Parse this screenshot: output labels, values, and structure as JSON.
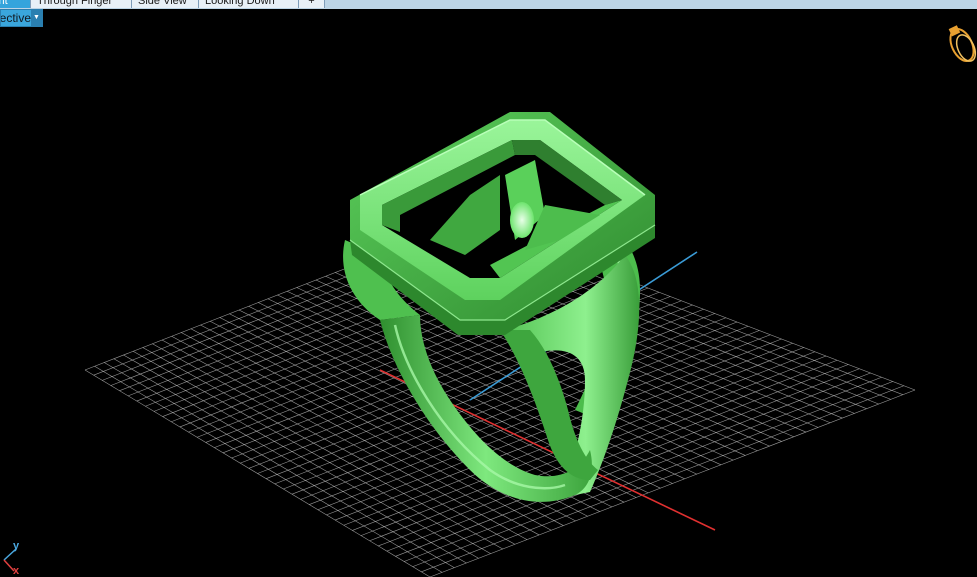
{
  "tabs": [
    {
      "label": "Front"
    },
    {
      "label": "Through Finger"
    },
    {
      "label": "Side View"
    },
    {
      "label": "Looking Down"
    },
    {
      "label": "+"
    }
  ],
  "view_mode": {
    "selected": "Perspective"
  },
  "axes": {
    "y_label": "y",
    "x_label": "x"
  },
  "colors": {
    "background": "#000000",
    "model": "#6ee46e",
    "grid": "#c8c8c8",
    "axis_x": "#e03030",
    "axis_y": "#3a9bd6",
    "tab_active": "#34a4dc"
  },
  "icons": {
    "view_gizmo": "ring-orientation-gizmo-icon",
    "dropdown": "chevron-down-icon"
  }
}
